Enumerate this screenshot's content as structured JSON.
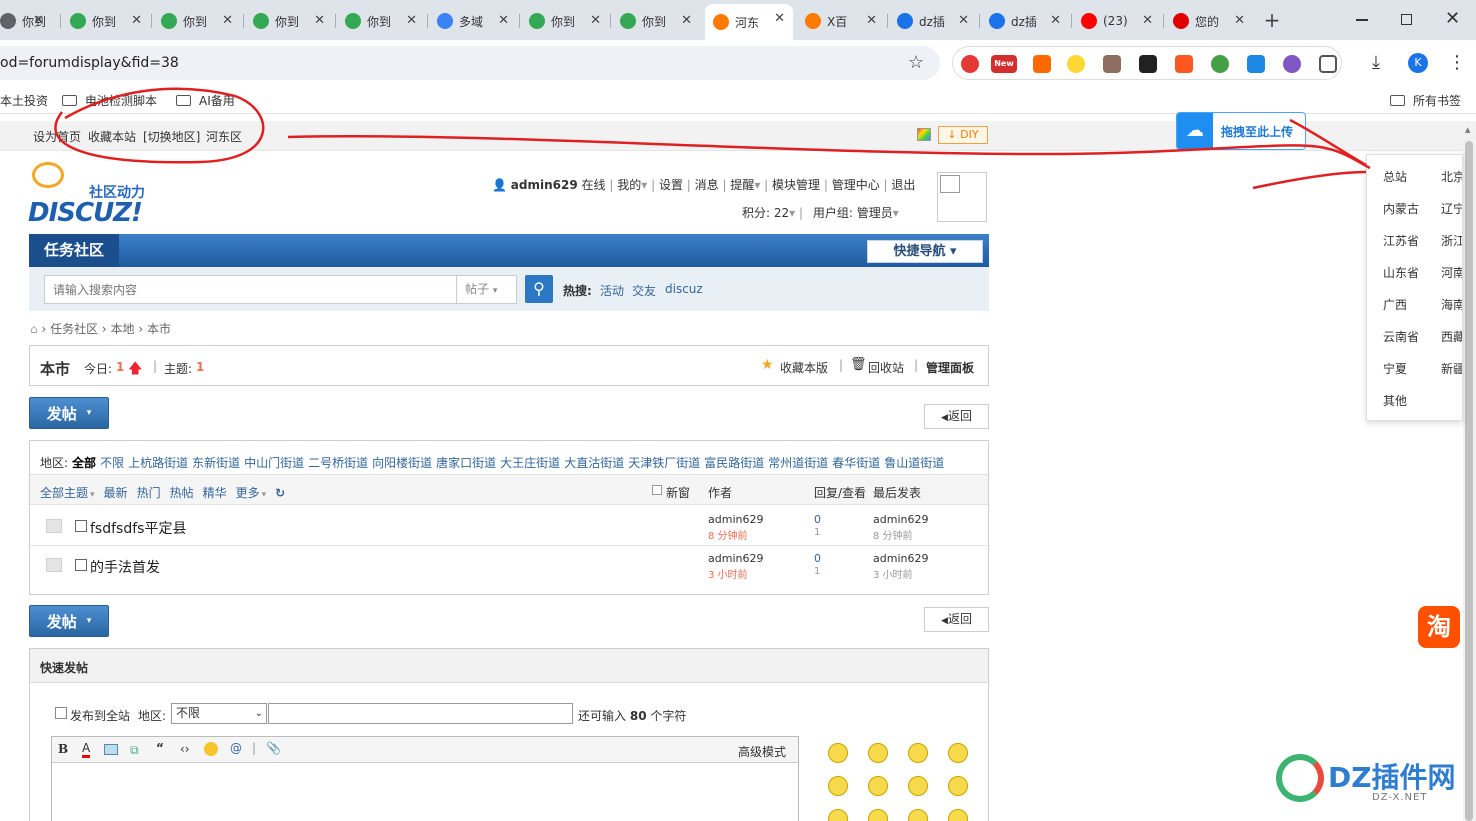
{
  "browser": {
    "tabs": [
      {
        "title": "你到",
        "fav_color": "#5f6368"
      },
      {
        "title": "你到",
        "fav_color": "#34a853"
      },
      {
        "title": "你到",
        "fav_color": "#34a853"
      },
      {
        "title": "你到",
        "fav_color": "#34a853"
      },
      {
        "title": "你到",
        "fav_color": "#34a853"
      },
      {
        "title": "多域",
        "fav_color": "#3b82f6"
      },
      {
        "title": "你到",
        "fav_color": "#34a853"
      },
      {
        "title": "你到",
        "fav_color": "#34a853"
      },
      {
        "title": "河东",
        "fav_color": "#ff7a00"
      },
      {
        "title": "X百",
        "fav_color": "#ff7a00"
      },
      {
        "title": "dz插",
        "fav_color": "#1a73e8"
      },
      {
        "title": "dz插",
        "fav_color": "#1a73e8"
      },
      {
        "title": "(23)",
        "fav_color": "#ff0000"
      },
      {
        "title": "您的",
        "fav_color": "#e00000"
      }
    ],
    "url": "od=forumdisplay&fid=38",
    "bookmarks": [
      "本土投资",
      "电池检测脚本",
      "AI备用"
    ],
    "all_bookmarks": "所有书签",
    "avatar_letter": "K"
  },
  "topbar": {
    "set_home": "设为首页",
    "bookmark": "收藏本站",
    "switch_region": "[切换地区]",
    "current_region": "河东区",
    "diy": "DIY"
  },
  "upload_tip": "拖拽至此上传",
  "region_popup": [
    "总站",
    "北京市",
    "内蒙古",
    "辽宁",
    "江苏省",
    "浙江",
    "山东省",
    "河南",
    "广西",
    "海南省",
    "云南省",
    "西藏",
    "宁夏",
    "新疆",
    "其他"
  ],
  "logo": {
    "tagline": "社区动力",
    "brand": "DISCUZ!"
  },
  "usernav": {
    "user": "admin629",
    "online": "在线",
    "items": [
      "我的",
      "设置",
      "消息",
      "提醒",
      "模块管理",
      "管理中心",
      "退出"
    ],
    "points_label": "积分: 22",
    "group_label": "用户组: 管理员"
  },
  "nav": {
    "title": "任务社区",
    "quicknav": "快捷导航"
  },
  "search": {
    "placeholder": "请输入搜索内容",
    "scope": "帖子",
    "hot_label": "热搜:",
    "hot": [
      "活动",
      "交友",
      "discuz"
    ]
  },
  "breadcrumb": [
    "任务社区",
    "本地",
    "本市"
  ],
  "forum": {
    "name": "本市",
    "today_label": "今日:",
    "today": "1",
    "threads_label": "主题:",
    "threads": "1",
    "fav": "收藏本版",
    "recycle": "回收站",
    "manage": "管理面板"
  },
  "actions": {
    "post": "发帖",
    "back": "返回"
  },
  "regions": {
    "label": "地区:",
    "items": [
      "全部",
      "不限",
      "上杭路街道",
      "东新街道",
      "中山门街道",
      "二号桥街道",
      "向阳楼街道",
      "唐家口街道",
      "大王庄街道",
      "大直沽街道",
      "天津铁厂街道",
      "富民路街道",
      "常州道街道",
      "春华街道",
      "鲁山道街道"
    ]
  },
  "filters": {
    "items": [
      "全部主题",
      "最新",
      "热门",
      "热帖",
      "精华",
      "更多"
    ],
    "new_window": "新窗",
    "author": "作者",
    "reply_view": "回复/查看",
    "last_post": "最后发表"
  },
  "threads": [
    {
      "title": "fsdfsdfs平定县",
      "author": "admin629",
      "author_time": "8 分钟前",
      "replies": "0",
      "views": "1",
      "last_user": "admin629",
      "last_time": "8 分钟前"
    },
    {
      "title": "的手法首发",
      "author": "admin629",
      "author_time": "3 小时前",
      "replies": "0",
      "views": "1",
      "last_user": "admin629",
      "last_time": "3 小时前"
    }
  ],
  "quickpost": {
    "title": "快速发帖",
    "global": "发布到全站",
    "region_label": "地区:",
    "region_value": "不限",
    "remain_pre": "还可输入",
    "remain": "80",
    "remain_post": "个字符",
    "advanced": "高级模式"
  },
  "watermark": {
    "text": "DZ插件网",
    "sub": "DZ-X.NET"
  }
}
